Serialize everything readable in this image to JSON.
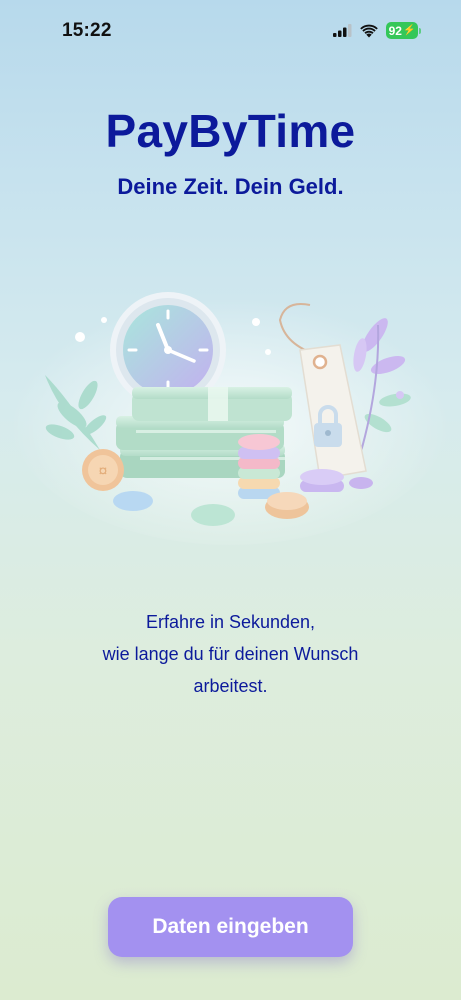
{
  "status_bar": {
    "time": "15:22",
    "battery_level": "92",
    "icons": [
      "cellular-signal-icon",
      "wifi-icon",
      "battery-charging-icon"
    ]
  },
  "header": {
    "title": "PayByTime",
    "tagline": "Deine Zeit. Dein Geld."
  },
  "hero": {
    "illustration": "clock-money-price-tag-illustration"
  },
  "intro": {
    "lines": [
      "Erfahre in Sekunden,",
      "wie lange du für deinen Wunsch",
      "arbeitest."
    ]
  },
  "cta": {
    "label": "Daten eingeben"
  },
  "colors": {
    "brand_text": "#0c1a9b",
    "cta_background": "#a391f0",
    "battery": "#34c759"
  }
}
